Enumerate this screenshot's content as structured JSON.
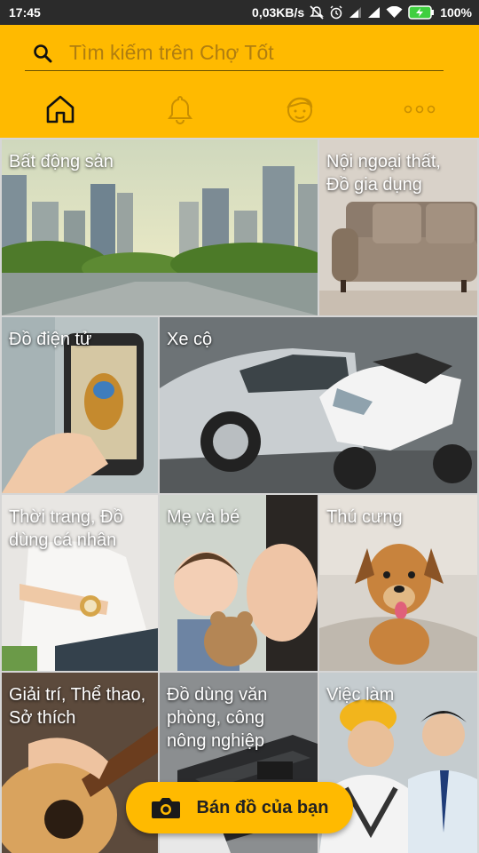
{
  "status_bar": {
    "time": "17:45",
    "speed": "0,03KB/s",
    "battery": "100%",
    "icons": [
      "mute-icon",
      "alarm-icon",
      "signal-icon",
      "signal-icon",
      "wifi-icon",
      "battery-icon"
    ]
  },
  "search": {
    "placeholder": "Tìm kiếm trên Chợ Tốt"
  },
  "nav": [
    {
      "name": "home-icon",
      "active": true
    },
    {
      "name": "bell-icon",
      "active": false
    },
    {
      "name": "profile-icon",
      "active": false
    },
    {
      "name": "more-icon",
      "active": false
    }
  ],
  "categories": [
    {
      "label": "Bất động sản"
    },
    {
      "label": "Nội ngoại thất,\nĐồ gia dụng"
    },
    {
      "label": "Đồ điện tử"
    },
    {
      "label": "Xe cộ"
    },
    {
      "label": "Thời trang, Đồ\ndùng cá nhân"
    },
    {
      "label": "Mẹ và bé"
    },
    {
      "label": "Thú cưng"
    },
    {
      "label": "Giải trí, Thể thao,\nSở thích"
    },
    {
      "label": "Đồ dùng văn\nphòng, công\nnông nghiệp"
    },
    {
      "label": "Việc làm"
    }
  ],
  "fab": {
    "label": "Bán đồ của bạn",
    "icon": "camera-icon"
  },
  "colors": {
    "brand": "#ffba00",
    "status_bar": "#2b2b2b"
  }
}
